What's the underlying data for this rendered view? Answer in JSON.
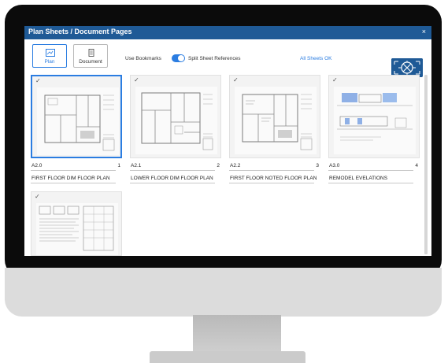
{
  "window": {
    "title": "Plan Sheets / Document Pages",
    "close_glyph": "×"
  },
  "toolbar": {
    "plan_label": "Plan",
    "document_label": "Document",
    "use_bookmarks_label": "Use Bookmarks",
    "split_sheet_label": "Split Sheet References",
    "split_sheet_enabled": true,
    "status_text": "All Sheets OK"
  },
  "sheets": [
    {
      "sheet": "A2.0",
      "page": "1",
      "title": "FIRST FLOOR DIM FLOOR PLAN",
      "selected": true,
      "checked": true
    },
    {
      "sheet": "A2.1",
      "page": "2",
      "title": "LOWER FLOOR DIM FLOOR PLAN",
      "selected": false,
      "checked": true
    },
    {
      "sheet": "A2.2",
      "page": "3",
      "title": "FIRST FLOOR NOTED FLOOR PLAN",
      "selected": false,
      "checked": true
    },
    {
      "sheet": "A3.0",
      "page": "4",
      "title": "REMODEL EVELATIONS",
      "selected": false,
      "checked": true
    },
    {
      "sheet": "",
      "page": "",
      "title": "",
      "selected": false,
      "checked": true
    }
  ],
  "check_glyph": "✓",
  "colors": {
    "titlebar": "#1f5a96",
    "accent": "#2b7de1"
  }
}
